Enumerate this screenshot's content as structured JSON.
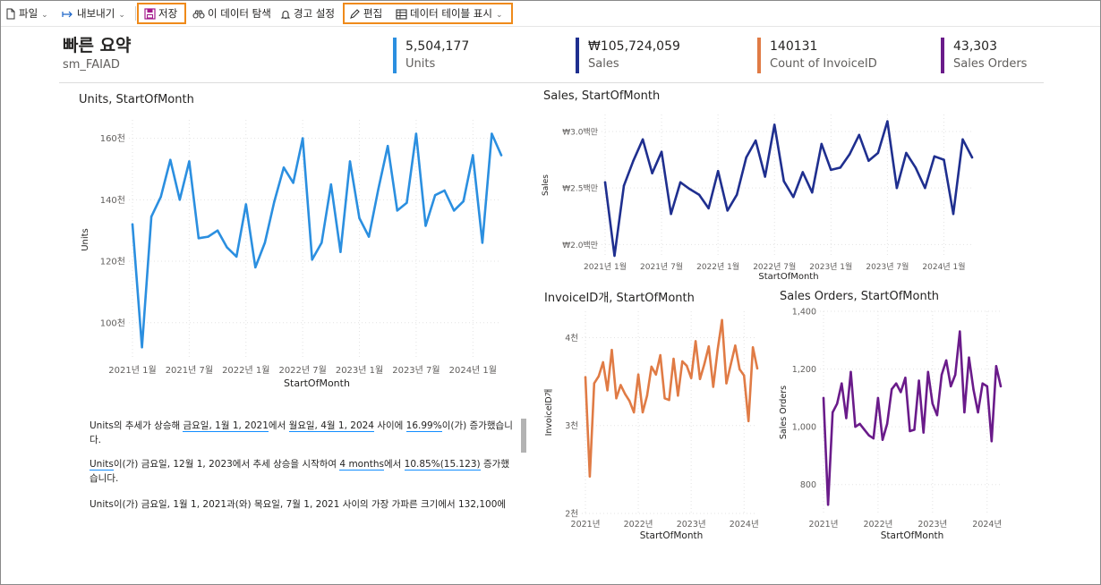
{
  "toolbar": {
    "file": "파일",
    "export": "내보내기",
    "save": "저장",
    "explore": "이 데이터 탐색",
    "alert": "경고 설정",
    "edit": "편집",
    "show_table": "데이터 테이블 표시"
  },
  "summary": {
    "title": "빠른 요약",
    "subtitle": "sm_FAIAD",
    "kpis": [
      {
        "value": "5,504,177",
        "label": "Units",
        "color": "#2b8fe0"
      },
      {
        "value": "₩105,724,059",
        "label": "Sales",
        "color": "#1f2f8f"
      },
      {
        "value": "140131",
        "label": "Count of InvoiceID",
        "color": "#e07b45"
      },
      {
        "value": "43,303",
        "label": "Sales Orders",
        "color": "#6a1b8a"
      }
    ]
  },
  "charts": {
    "units": {
      "title": "Units, StartOfMonth",
      "xlabel": "StartOfMonth",
      "ylabel": "Units",
      "yticks": [
        "160천",
        "140천",
        "120천",
        "100천"
      ],
      "xticks": [
        "2021년 1월",
        "2021년 7월",
        "2022년 1월",
        "2022년 7월",
        "2023년 1월",
        "2023년 7월",
        "2024년 1월"
      ]
    },
    "sales": {
      "title": "Sales, StartOfMonth",
      "xlabel": "StartOfMonth",
      "ylabel": "Sales",
      "yticks": [
        "₩3.0백만",
        "₩2.5백만",
        "₩2.0백만"
      ],
      "xticks": [
        "2021년 1월",
        "2021년 7월",
        "2022년 1월",
        "2022년 7월",
        "2023년 1월",
        "2023년 7월",
        "2024년 1월"
      ]
    },
    "invoice": {
      "title": "InvoiceID개, StartOfMonth",
      "xlabel": "StartOfMonth",
      "ylabel": "InvoiceID개",
      "yticks": [
        "4천",
        "3천",
        "2천"
      ],
      "xticks": [
        "2021년",
        "2022년",
        "2023년",
        "2024년"
      ]
    },
    "orders": {
      "title": "Sales Orders, StartOfMonth",
      "xlabel": "StartOfMonth",
      "ylabel": "Sales Orders",
      "yticks": [
        "1,400",
        "1,200",
        "1,000",
        "800"
      ],
      "xticks": [
        "2021년",
        "2022년",
        "2023년",
        "2024년"
      ]
    }
  },
  "narrative": {
    "p1": {
      "a": "Units의 추세가 상승해 ",
      "b": "금요일, 1월 1, 2021",
      "c": "에서 ",
      "d": "월요일, 4월 1, 2024",
      "e": " 사이에 ",
      "f": "16.99%",
      "g": "이(가) 증가했습니다."
    },
    "p2": {
      "a": "Units",
      "b": "이(가) 금요일, 12월 1, 2023에서 추세 상승을 시작하여 ",
      "c": "4 months",
      "d": "에서 ",
      "e": "10.85%(15.123)",
      "f": " 증가했습니다."
    },
    "p3": "Units이(가) 금요일, 1월 1, 2021과(와) 목요일, 7월 1, 2021 사이의 가장 가파른 크기에서 132,100에"
  },
  "chart_data": [
    {
      "type": "line",
      "title": "Units, StartOfMonth",
      "xlabel": "StartOfMonth",
      "ylabel": "Units",
      "ylim": [
        88000,
        166000
      ],
      "x_start": "2021-01",
      "x_end": "2024-04",
      "series": [
        {
          "name": "Units",
          "color": "#2b8fe0",
          "values": [
            132000,
            92000,
            134500,
            141000,
            153000,
            140000,
            152500,
            127500,
            128000,
            130000,
            124500,
            121500,
            138500,
            118000,
            126000,
            139500,
            150500,
            145500,
            160000,
            120500,
            126000,
            145000,
            123000,
            152500,
            134000,
            128000,
            143500,
            157500,
            136500,
            139000,
            161500,
            131500,
            141500,
            143000,
            136500,
            139500,
            154500,
            126000,
            161500,
            154500
          ]
        }
      ]
    },
    {
      "type": "line",
      "title": "Sales, StartOfMonth",
      "xlabel": "StartOfMonth",
      "ylabel": "Sales",
      "ylim": [
        1900000,
        3150000
      ],
      "x_start": "2021-01",
      "x_end": "2024-04",
      "series": [
        {
          "name": "Sales",
          "color": "#1f2f8f",
          "values": [
            2550000,
            1900000,
            2520000,
            2740000,
            2930000,
            2630000,
            2820000,
            2270000,
            2550000,
            2490000,
            2440000,
            2320000,
            2650000,
            2300000,
            2440000,
            2770000,
            2920000,
            2600000,
            3060000,
            2560000,
            2420000,
            2640000,
            2460000,
            2890000,
            2660000,
            2680000,
            2800000,
            2970000,
            2740000,
            2810000,
            3090000,
            2500000,
            2810000,
            2680000,
            2500000,
            2780000,
            2750000,
            2270000,
            2930000,
            2770000
          ]
        }
      ]
    },
    {
      "type": "line",
      "title": "InvoiceID개, StartOfMonth",
      "xlabel": "StartOfMonth",
      "ylabel": "InvoiceID개",
      "ylim": [
        2000,
        4300
      ],
      "x_start": "2021-01",
      "x_end": "2024-04",
      "series": [
        {
          "name": "InvoiceID개",
          "color": "#e07b45",
          "values": [
            3550,
            2420,
            3480,
            3560,
            3720,
            3400,
            3860,
            3310,
            3460,
            3360,
            3280,
            3150,
            3580,
            3150,
            3340,
            3670,
            3580,
            3800,
            3310,
            3290,
            3760,
            3340,
            3730,
            3680,
            3540,
            3960,
            3530,
            3700,
            3900,
            3440,
            3860,
            4200,
            3480,
            3700,
            3910,
            3640,
            3570,
            3050,
            3890,
            3650
          ]
        }
      ]
    },
    {
      "type": "line",
      "title": "Sales Orders, StartOfMonth",
      "xlabel": "StartOfMonth",
      "ylabel": "Sales Orders",
      "ylim": [
        700,
        1400
      ],
      "x_start": "2021-01",
      "x_end": "2024-04",
      "series": [
        {
          "name": "Sales Orders",
          "color": "#6a1b8a",
          "values": [
            1100,
            730,
            1050,
            1080,
            1150,
            1030,
            1190,
            1000,
            1010,
            990,
            970,
            960,
            1100,
            955,
            1010,
            1130,
            1150,
            1120,
            1170,
            985,
            990,
            1160,
            980,
            1190,
            1080,
            1040,
            1180,
            1230,
            1140,
            1180,
            1330,
            1050,
            1240,
            1130,
            1050,
            1150,
            1140,
            950,
            1210,
            1140
          ]
        }
      ]
    }
  ]
}
